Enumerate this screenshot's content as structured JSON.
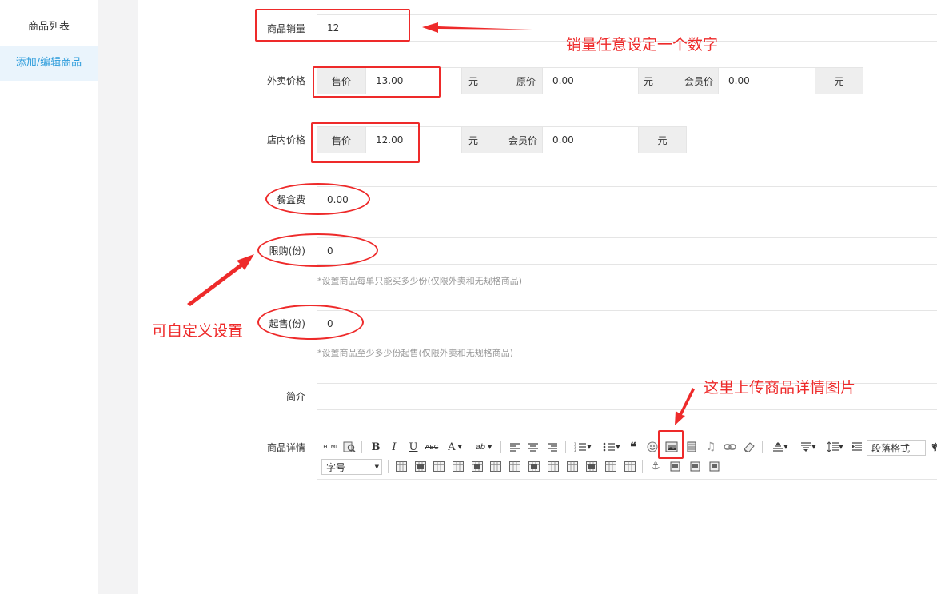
{
  "sidebar": {
    "items": [
      {
        "label": "商品列表"
      },
      {
        "label": "添加/编辑商品"
      }
    ]
  },
  "form": {
    "sales": {
      "label": "商品销量",
      "value": "12"
    },
    "takeaway_price": {
      "label": "外卖价格",
      "sale_label": "售价",
      "sale_value": "13.00",
      "sale_unit": "元",
      "original_label": "原价",
      "original_value": "0.00",
      "original_unit": "元",
      "member_label": "会员价",
      "member_value": "0.00",
      "member_unit": "元"
    },
    "store_price": {
      "label": "店内价格",
      "sale_label": "售价",
      "sale_value": "12.00",
      "sale_unit": "元",
      "member_label": "会员价",
      "member_value": "0.00",
      "member_unit": "元"
    },
    "box_fee": {
      "label": "餐盒费",
      "value": "0.00"
    },
    "purchase_limit": {
      "label": "限购(份)",
      "value": "0",
      "hint": "*设置商品每单只能买多少份(仅限外卖和无规格商品)"
    },
    "min_order": {
      "label": "起售(份)",
      "value": "0",
      "hint": "*设置商品至少多少份起售(仅限外卖和无规格商品)"
    },
    "intro": {
      "label": "简介",
      "value": ""
    },
    "detail": {
      "label": "商品详情",
      "toolbar": {
        "html_label": "HTML",
        "paragraph_format": "段落格式",
        "font_size": "字号"
      }
    }
  },
  "annotations": {
    "sales_note": "销量任意设定一个数字",
    "custom_note": "可自定义设置",
    "upload_note": "这里上传商品详情图片",
    "color": "#ee2a2a"
  }
}
